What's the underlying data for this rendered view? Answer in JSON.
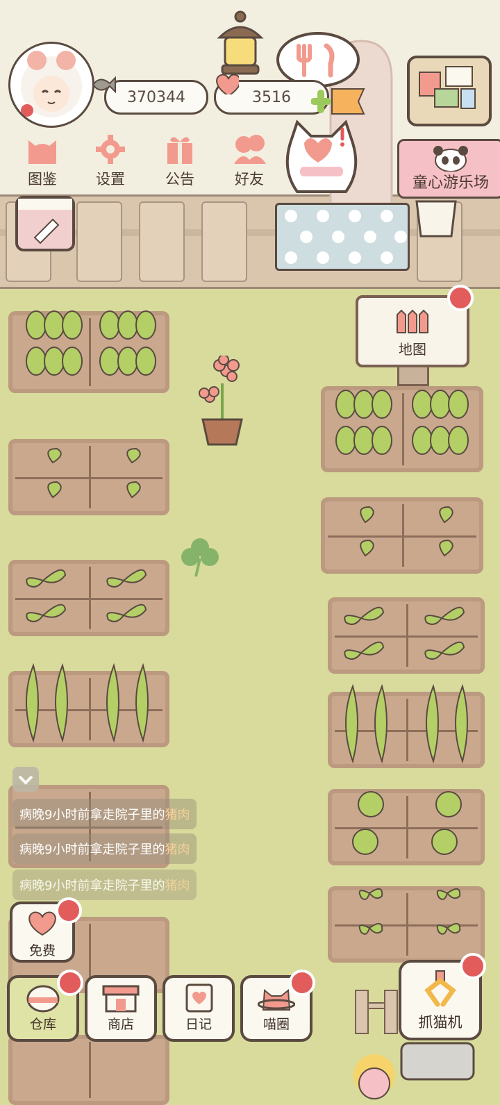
{
  "currency": {
    "fish_coins": "370344",
    "hearts": "3516"
  },
  "top_menu": [
    {
      "label": "图鉴",
      "icon": "cat-head-icon"
    },
    {
      "label": "设置",
      "icon": "gear-icon"
    },
    {
      "label": "公告",
      "icon": "gift-icon"
    },
    {
      "label": "好友",
      "icon": "friends-icon"
    }
  ],
  "park_sign": {
    "label": "童心游乐场"
  },
  "map_sign": {
    "label": "地图"
  },
  "feed": {
    "messages": [
      {
        "prefix": "病晚9小时前拿走院子里的",
        "item": "猪肉"
      },
      {
        "prefix": "病晚9小时前拿走院子里的",
        "item": "猪肉"
      },
      {
        "prefix": "病晚9小时前拿走院子里的",
        "item": "猪肉"
      }
    ]
  },
  "bottom_bar": {
    "free": "免费",
    "warehouse": "仓库",
    "shop": "商店",
    "diary": "日记",
    "cat_circle": "喵圈",
    "claw_machine": "抓猫机"
  },
  "colors": {
    "grass": "#d8db9c",
    "soil": "#c9a88e",
    "outline": "#5a4a40",
    "notify_red": "#e25c5c",
    "accent_pink": "#f29a8e"
  }
}
